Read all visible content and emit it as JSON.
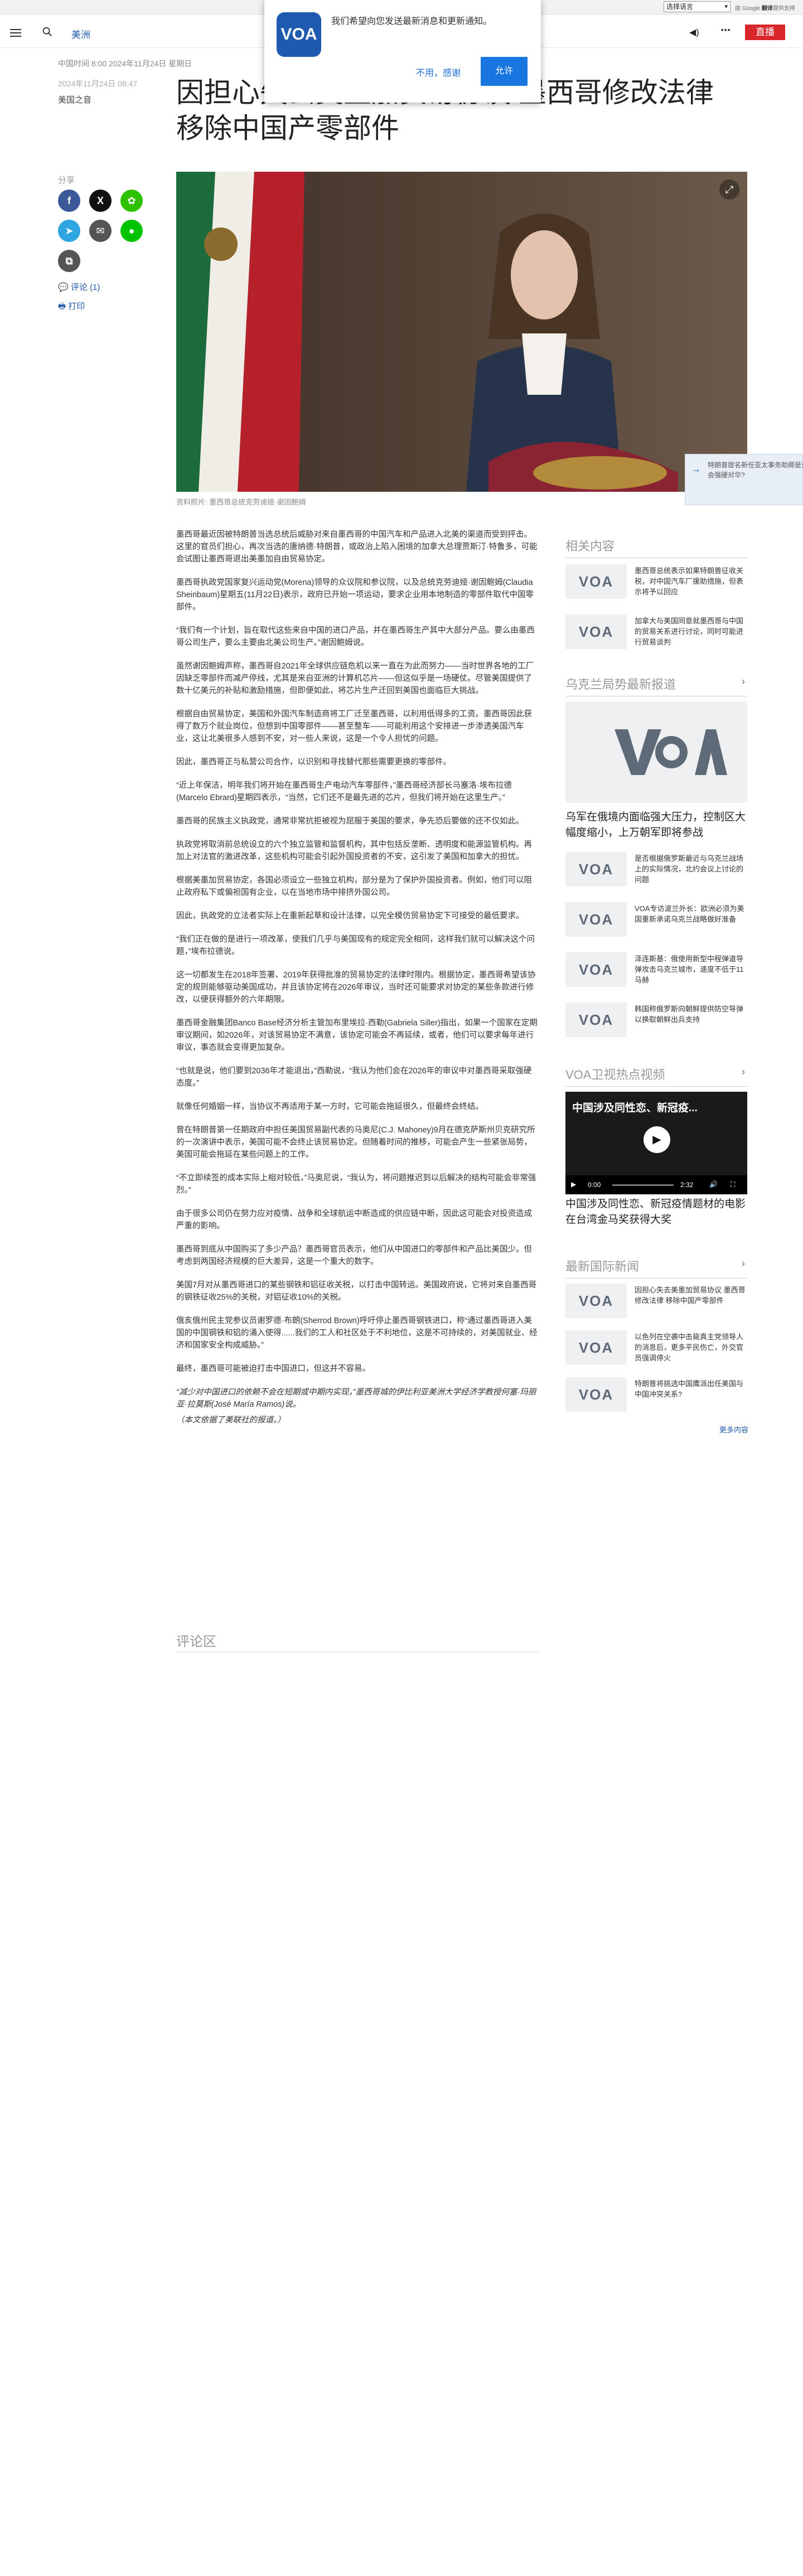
{
  "topbar": {
    "language_select": "选择语言",
    "powered_by": "由 Google",
    "translate": "翻译",
    "translate_suffix": "提供支持"
  },
  "nav": {
    "region": "美洲",
    "live": "直播"
  },
  "notification": {
    "message": "我们希望向您发送最新消息和更新通知。",
    "deny": "不用，感谢",
    "allow": "允许",
    "logo": "VOA"
  },
  "article": {
    "dates": "中国时间 8:00 2024年11月24日 星期日",
    "dates_updated": "2024年11月24日 08:47",
    "source": "美国之音",
    "headline": "因担心失去美墨加贸易协议 墨西哥修改法律 移除中国产零部件",
    "share_label": "分享",
    "comment_link": "评论 (1)",
    "print_link": "打印",
    "caption": "资料照片: 墨西哥总统克劳迪娅·谢因鲍姆",
    "paragraphs": [
      "墨西哥最近因被特朗普当选总统后威胁对来自墨西哥的中国汽车和产品进入北美的渠道而受到抨击。这里的官员们担心，再次当选的唐纳德·特朗普，或政治上陷入困境的加拿大总理贾斯汀·特鲁多，可能会试图让墨西哥退出美墨加自由贸易协定。",
      "墨西哥执政党国家复兴运动党(Morena)领导的众议院和参议院，以及总统克劳迪娅·谢因鲍姆(Claudia Sheinbaum)星期五(11月22日)表示，政府已开始一项运动，要求企业用本地制造的零部件取代中国零部件。",
      "“我们有一个计划，旨在取代这些来自中国的进口产品，并在墨西哥生产其中大部分产品。要么由墨西哥公司生产，要么主要由北美公司生产。”谢因鲍姆说。",
      "虽然谢因鲍姆声称，墨西哥自2021年全球供应链危机以来一直在为此而努力——当时世界各地的工厂因缺乏零部件而减产停线，尤其是来自亚洲的计算机芯片——但这似乎是一场硬仗。尽管美国提供了数十亿美元的补贴和激励措施，但即便如此，将芯片生产迁回到美国也面临巨大挑战。",
      "根据自由贸易协定，美国和外国汽车制造商将工厂迁至墨西哥，以利用低得多的工资。墨西哥因此获得了数万个就业岗位，但想到中国零部件——甚至整车——可能利用这个安排进一步渗透美国汽车业，这让北美很多人感到不安，对一些人来说，这是一个令人担忧的问题。",
      "因此，墨西哥正与私营公司合作，以识别和寻找替代那些需要更换的零部件。",
      "“近上年保洁，明年我们将开始在墨西哥生产电动汽车零部件，”墨西哥经济部长马塞洛·埃布拉德(Marcelo Ebrard)星期四表示，“当然，它们还不是最先进的芯片，但我们将开始在这里生产。”",
      "墨西哥的民族主义执政党，通常非常抗拒被视为屈服于美国的要求，争先恐后要做的还不仅如此。",
      "执政党将取消前总统设立的六个独立监管和监督机构，其中包括反垄断、透明度和能源监管机构。再加上对法官的激进改革，这些机构可能会引起外国投资者的不安，这引发了美国和加拿大的担忧。",
      "根据美墨加贸易协定，各国必须设立一些独立机构，部分是为了保护外国投资者。例如，他们可以阻止政府私下或偏袒国有企业，以在当地市场中排挤外国公司。",
      "因此，执政党的立法者实际上在重新起草和设计法律，以完全模仿贸易协定下可接受的最低要求。",
      "“我们正在做的是进行一项改革，使我们几乎与美国现有的规定完全相同，这样我们就可以解决这个问题，”埃布拉德说。",
      "这一切都发生在2018年签署、2019年获得批准的贸易协定的法律时限内。根据协定，墨西哥希望该协定的规则能够驱动美国成功，并且该协定将在2026年审议，当时还可能要求对协定的某些条款进行修改，以便获得额外的六年期限。",
      "墨西哥金融集团Banco Base经济分析主管加布里埃拉·西勒(Gabriela Siller)指出，如果一个国家在定期审议期间，如2026年，对该贸易协定不满意，该协定可能会不再延续，或者，他们可以要求每年进行审议，事态就会变得更加复杂。",
      "“也就是说，他们要到2036年才能退出，”西勒说，“我认为他们会在2026年的审议中对墨西哥采取强硬态度。”",
      "就像任何婚姻一样，当协议不再适用于某一方时，它可能会拖延很久，但最终会终结。",
      "曾在特朗普第一任期政府中担任美国贸易副代表的马奥尼(C.J. Mahoney)9月在德克萨斯州贝克研究所的一次演讲中表示，美国可能不会终止该贸易协定。但随着时间的推移，可能会产生一些紧张局势，美国可能会拖延在某些问题上的工作。",
      "“不立即续签的成本实际上相对较低，”马奥尼说，“我认为，将问题推迟到以后解决的结构可能会非常强烈。”",
      "由于很多公司仍在努力应对疫情、战争和全球航运中断造成的供应链中断，因此这可能会对投资造成严重的影响。",
      "墨西哥到底从中国购买了多少产品？墨西哥官员表示，他们从中国进口的零部件和产品比美国少。但考虑到两国经济规模的巨大差异，这是一个重大的数字。",
      "美国7月对从墨西哥进口的某些钢铁和铝征收关税，以打击中国转运。美国政府说，它将对来自墨西哥的钢铁征收25%的关税，对铝征收10%的关税。",
      "俄亥俄州民主党参议员谢罗德·布朗(Sherrod Brown)呼吁停止墨西哥钢铁进口，称“通过墨西哥进入美国的中国钢铁和铝的涌入使得......我们的工人和社区处于不利地位，这是不可持续的，对美国就业、经济和国家安全构成威胁。”",
      "最终，墨西哥可能被迫打击中国进口，但这并不容易。",
      "“减少对中国进口的依赖不会在短期或中期内实现，”墨西哥城的伊比利亚美洲大学经济学教授何塞·玛丽亚·拉莫斯(José María Ramos)说。"
    ],
    "note": "（本文依据了美联社的报道。）",
    "comments_title": "评论区"
  },
  "sidebar": {
    "related_title": "相关内容",
    "related": [
      {
        "text": "墨西哥总统表示如果特朗普征收关税，对中国汽车厂援助措施，但表示将予以回应"
      },
      {
        "text": "加拿大与美国同意就墨西哥与中国的贸易关系进行讨论，同时可能进行贸易谈判"
      }
    ],
    "ukraine_title": "乌克兰局势最新报道",
    "ukraine_lead": "乌军在俄境内面临强大压力，控制区大幅度缩小，上万朝军即将参战",
    "ukraine": [
      {
        "text": "是否根据俄罗斯最近与乌克兰战场上的实际情况，北约会议上讨论的问题"
      },
      {
        "text": "VOA专访波兰外长：欧洲必须为美国重新承诺乌克兰战略做好准备"
      },
      {
        "text": "泽连斯基：俄使用新型中程弹道导弹攻击乌克兰城市，速度不低于11马赫"
      },
      {
        "text": "韩国称俄罗斯向朝鲜提供防空导弹以换取朝鲜出兵支持"
      }
    ],
    "video_title": "VOA卫视热点视频",
    "video_overlay": "中国涉及同性恋、新冠疫...",
    "video_time_current": "0:00",
    "video_time_total": "2:32",
    "video_caption": "中国涉及同性恋、新冠疫情题材的电影在台湾金马奖获得大奖",
    "intl_title": "最新国际新闻",
    "intl": [
      {
        "text": "因担心失去美墨加贸易协议 墨西哥修改法律 移除中国产零部件"
      },
      {
        "text": "以色列在空袭中击毙真主党领导人的消息后，更多平民伤亡，外交官员强调停火"
      },
      {
        "text": "特朗普将挑选中国鹰派出任美国与中国冲突关系?"
      }
    ],
    "more": "更多内容",
    "promo": "特朗普提名新任亚太事务助卿是否会强硬对华?",
    "logo": "VOA"
  },
  "colors": {
    "accent": "#1f5aa8",
    "live": "#d9262b",
    "facebook": "#3b5998",
    "x": "#111111",
    "wechat": "#2dc100",
    "telegram": "#2ca5e0",
    "email": "#555555",
    "line": "#00c300",
    "copy": "#555555"
  }
}
